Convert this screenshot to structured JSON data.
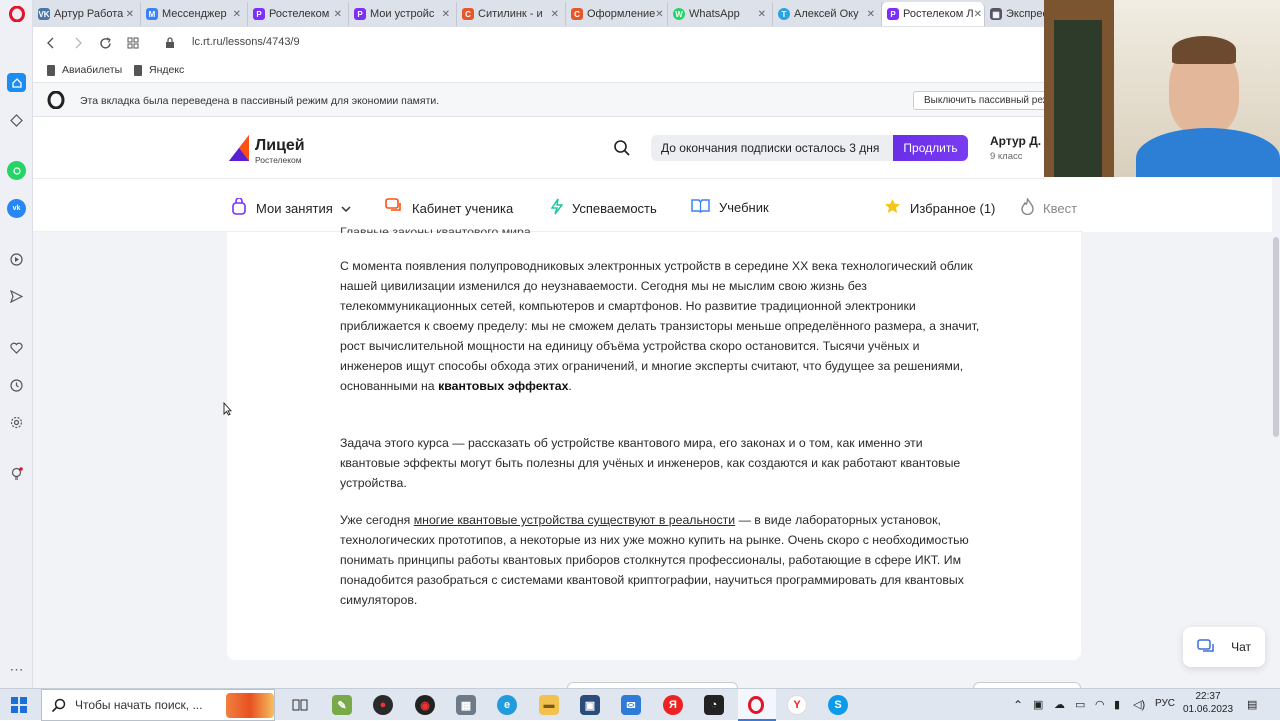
{
  "browser": {
    "tabs": [
      {
        "label": "Артур Работа",
        "color": "#4a76a8",
        "glyph": "VK"
      },
      {
        "label": "Мессенджер",
        "color": "#3b82f6",
        "glyph": "M"
      },
      {
        "label": "Ростелеком",
        "color": "#7b2ff7",
        "glyph": "Р"
      },
      {
        "label": "Мои устройс",
        "color": "#7b2ff7",
        "glyph": "Р"
      },
      {
        "label": "Ситилинк - и",
        "color": "#e8572a",
        "glyph": "С"
      },
      {
        "label": "Оформление",
        "color": "#e8572a",
        "glyph": "С"
      },
      {
        "label": "WhatsApp",
        "color": "#25d366",
        "glyph": "W"
      },
      {
        "label": "Алексей Оку",
        "color": "#2aa3e0",
        "glyph": "T"
      },
      {
        "label": "Ростелеком Л",
        "color": "#7b2ff7",
        "glyph": "Р"
      },
      {
        "label": "Экспресс",
        "color": "#556",
        "glyph": "▦"
      }
    ],
    "url": "lc.rt.ru/lessons/4743/9",
    "bookmarks": [
      "Авиабилеты",
      "Яндекс"
    ],
    "notification": {
      "text": "Эта вкладка была переведена в пассивный режим для экономии памяти.",
      "button": "Выключить пассивный реж"
    }
  },
  "site": {
    "logo_title": "Лицей",
    "logo_sub": "Ростелеком",
    "subscription_text": "До окончания подписки осталось 3 дня",
    "renew_button": "Продлить",
    "user_name": "Артур Д.",
    "user_grade": "9 класс",
    "nav": {
      "my_lessons": "Мои занятия",
      "student_cabinet": "Кабинет ученика",
      "progress": "Успеваемость",
      "textbook": "Учебник",
      "favorites": "Избранное (1)",
      "quest": "Квест"
    },
    "heading_partial": "Главные законы квантового мира",
    "paragraphs": {
      "p1_part1": "С момента появления полупроводниковых электронных устройств в середине XX века технологический облик нашей цивилизации изменился до неузнаваемости. Сегодня мы не мыслим свою жизнь без телекоммуникационных сетей, компьютеров и смартфонов. Но развитие традиционной электроники приближается к своему пределу: мы не сможем делать транзисторы меньше определённого размера, а значит, рост вычислительной мощности на единицу объёма устройства скоро остановится. Тысячи учёных и инженеров ищут способы обхода этих ограничений, и многие эксперты считают, что будущее за решениями, основанными на ",
      "p1_bold": "квантовых эффектах",
      "p1_end": ".",
      "p2": "Задача этого курса — рассказать об устройстве квантового мира, его законах и о том, как именно эти квантовые эффекты могут быть полезны для учёных и инженеров, как создаются и как работают квантовые устройства.",
      "p3_start": "Уже сегодня ",
      "p3_link": "многие квантовые устройства существуют в реальности",
      "p3_rest": " — в виде лабораторных установок, технологических прототипов, а некоторые из них уже можно купить на рынке. Очень скоро с необходимостью понимать принципы работы квантовых приборов столкнутся профессионалы, работающие в сфере ИКТ. Им понадобится разобраться с системами квантовой криптографии, научиться программировать для квантовых симуляторов."
    },
    "chat_label": "Чат"
  },
  "taskbar": {
    "search_placeholder": "Чтобы начать поиск, ...",
    "lang": "РУС",
    "time": "22:37",
    "date": "01.06.2023"
  },
  "colors": {
    "accent": "#6a2ee8",
    "sidebar_bg": "#eef0f5",
    "tabbar_bg": "#dde1e9"
  }
}
